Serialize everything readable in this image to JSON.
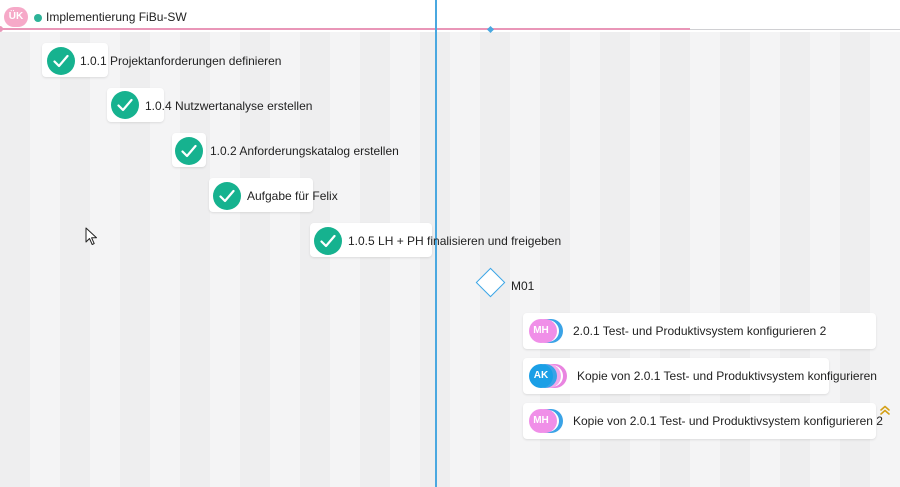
{
  "project": {
    "avatar_initials": "ÜK",
    "name": "Implementierung FiBu-SW"
  },
  "tasks": [
    {
      "label": "1.0.1 Projektanforderungen definieren",
      "status": "done"
    },
    {
      "label": "1.0.4 Nutzwertanalyse erstellen",
      "status": "done"
    },
    {
      "label": "1.0.2 Anforderungskatalog erstellen",
      "status": "done"
    },
    {
      "label": "Aufgabe für Felix",
      "status": "done"
    },
    {
      "label": "1.0.5 LH + PH finalisieren und freigeben",
      "status": "done"
    }
  ],
  "milestone": {
    "label": "M01"
  },
  "assigned_tasks": [
    {
      "initials": "MH",
      "label": "2.0.1 Test- und Produktivsystem konfigurieren 2",
      "avatar_color": "#f08fe8"
    },
    {
      "initials": "AK",
      "label": "Kopie von 2.0.1 Test- und Produktivsystem konfigurieren",
      "avatar_color": "#1a9fe6"
    },
    {
      "initials": "MH",
      "label": "Kopie von 2.0.1 Test- und Produktivsystem konfigurieren 2",
      "avatar_color": "#f08fe8"
    }
  ],
  "colors": {
    "done": "#16b28f",
    "today_line": "#4aa8e0",
    "project_track": "#e996b8",
    "milestone_border": "#3da6e6",
    "priority_icon": "#d4a017"
  },
  "icons": {
    "check": "check-circle-icon",
    "milestone": "diamond-icon",
    "priority": "double-chevron-up-icon",
    "cursor": "mouse-pointer-icon"
  }
}
